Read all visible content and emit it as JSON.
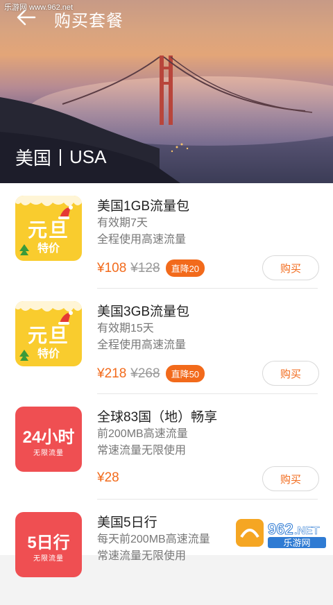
{
  "watermark": "乐游网 www.962.net",
  "header": {
    "title": "购买套餐"
  },
  "hero": {
    "region_cn": "美国",
    "region_en": "USA"
  },
  "packages": [
    {
      "thumb_top": "元旦",
      "thumb_bottom": "特价",
      "name": "美国1GB流量包",
      "line1": "有效期7天",
      "line2": "全程使用高速流量",
      "price": "¥108",
      "original_price": "¥128",
      "discount": "直降20",
      "buy_label": "购买"
    },
    {
      "thumb_top": "元旦",
      "thumb_bottom": "特价",
      "name": "美国3GB流量包",
      "line1": "有效期15天",
      "line2": "全程使用高速流量",
      "price": "¥218",
      "original_price": "¥268",
      "discount": "直降50",
      "buy_label": "购买"
    },
    {
      "thumb_top": "24小时",
      "thumb_bottom": "无限流量",
      "name": "全球83国（地）畅享",
      "line1": "前200MB高速流量",
      "line2": "常速流量无限使用",
      "price": "¥28",
      "buy_label": "购买"
    },
    {
      "thumb_top": "5日行",
      "thumb_bottom": "无限流量",
      "name": "美国5日行",
      "line1": "每天前200MB高速流量",
      "line2": "常速流量无限使用"
    }
  ],
  "logo": {
    "number": "962",
    "suffix": ".NET",
    "subtitle": "乐游网"
  }
}
